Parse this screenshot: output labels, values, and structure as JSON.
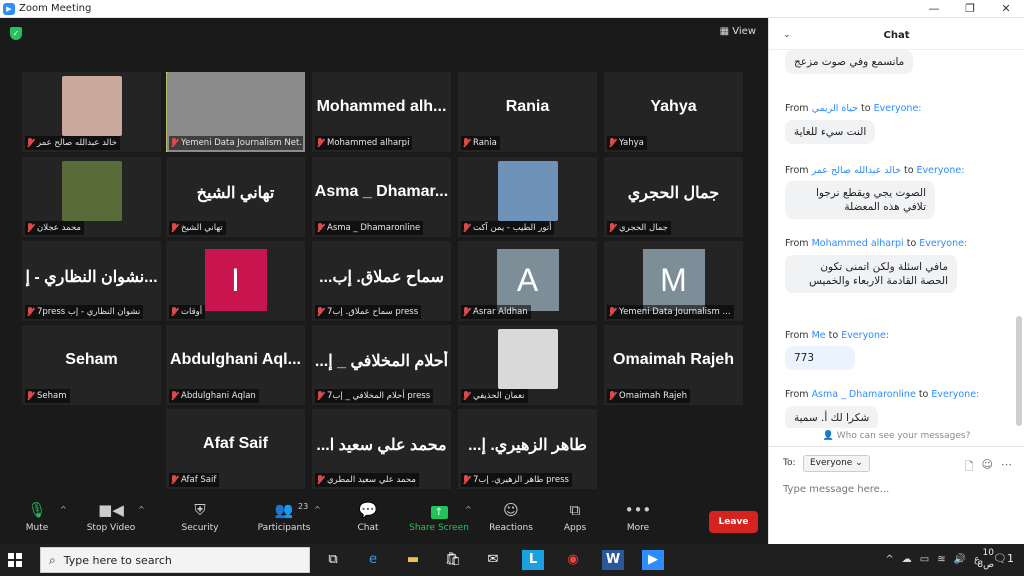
{
  "window": {
    "title": "Zoom Meeting",
    "minimize": "—",
    "maximize": "❐",
    "close": "✕"
  },
  "meeting": {
    "view_label": "View"
  },
  "tiles": [
    {
      "name": "",
      "label": "خالد عبدالله صالح عمر",
      "type": "photo",
      "photo_color": "#c9a99b"
    },
    {
      "name": "",
      "label": "Yemeni Data Journalism Net...",
      "type": "photo",
      "photo_color": "#8c8c8c",
      "active": true
    },
    {
      "name": "Mohammed  alh...",
      "label": "Mohammed alharpi",
      "type": "name"
    },
    {
      "name": "Rania",
      "label": "Rania",
      "type": "name"
    },
    {
      "name": "Yahya",
      "label": "Yahya",
      "type": "name"
    },
    {
      "name": "",
      "label": "محمد عجلان",
      "type": "photo",
      "photo_color": "#5a6b3a"
    },
    {
      "name": "تهاني الشيخ",
      "label": "تهاني الشيخ",
      "type": "name"
    },
    {
      "name": "Asma _ Dhamar...",
      "label": "Asma _ Dhamaronline",
      "type": "name"
    },
    {
      "name": "",
      "label": "أنور الطيب - يمن آكت",
      "type": "photo",
      "photo_color": "#6f93b8"
    },
    {
      "name": "جمال الحجري",
      "label": "جمال الحجري",
      "type": "name"
    },
    {
      "name": "نشوان النظاري - إ...",
      "label": "7press نشوان النظاري - إب",
      "type": "name"
    },
    {
      "name": "",
      "label": "أوقات",
      "type": "letter",
      "letter": "I",
      "letter_color": "#c8154f"
    },
    {
      "name": "...سماح عملاق. إب",
      "label": "7سماح عملاق. إب press",
      "type": "name"
    },
    {
      "name": "",
      "label": "Asrar Aldhan",
      "type": "letter",
      "letter": "A",
      "letter_color": "#7d8e99"
    },
    {
      "name": "",
      "label": "Yemeni Data Journalism ...",
      "type": "letter",
      "letter": "M",
      "letter_color": "#7d8e99"
    },
    {
      "name": "Seham",
      "label": "Seham",
      "type": "name"
    },
    {
      "name": "Abdulghani  Aql...",
      "label": "Abdulghani Aqlan",
      "type": "name"
    },
    {
      "name": "...أحلام المخلافي _ إ",
      "label": "7أحلام المخلافي _ إب press",
      "type": "name"
    },
    {
      "name": "",
      "label": "نعمان الحذيفي",
      "type": "photo",
      "photo_color": "#d9d9d9"
    },
    {
      "name": "Omaimah Rajeh",
      "label": "Omaimah Rajeh",
      "type": "name"
    },
    {
      "name": "Afaf Saif",
      "label": "Afaf Saif",
      "type": "name"
    },
    {
      "name": "...محمد علي سعيد ا",
      "label": "محمد علي سعيد المطري",
      "type": "name"
    },
    {
      "name": "...طاهر الزهيري. إ",
      "label": "7طاهر الزهيري. إب press",
      "type": "name"
    }
  ],
  "toolbar": {
    "mute": "Mute",
    "stop_video": "Stop Video",
    "security": "Security",
    "participants": "Participants",
    "participants_count": "23",
    "chat": "Chat",
    "share_screen": "Share Screen",
    "reactions": "Reactions",
    "apps": "Apps",
    "more": "More",
    "leave": "Leave"
  },
  "chat": {
    "title": "Chat",
    "messages": [
      {
        "from": "",
        "sender": "",
        "to": "",
        "text": "مانسمع وفي صوت مزعج"
      },
      {
        "from": "From",
        "sender": "حياة الريمي",
        "to": "Everyone:",
        "text": "النت سيء للغاية"
      },
      {
        "from": "From",
        "sender": "خالد عبدالله صالح عمر",
        "to": "Everyone:",
        "text": "الصوت يجي ويقطع نرجوا تلافي هذه المعضلة"
      },
      {
        "from": "From",
        "sender": "Mohammed alharpi",
        "to": "Everyone:",
        "text": "مافي اسئلة ولكن اتمنى تكون الحصة القادمة الاربعاء والخميس"
      },
      {
        "from": "From",
        "sender": "Me",
        "to": "Everyone:",
        "text": "773"
      },
      {
        "from": "From",
        "sender": "Asma _ Dhamaronline",
        "to": "Everyone:",
        "text": "شكرا لك أ. سمية"
      }
    ],
    "who_can_see": "Who can see your messages?",
    "to_label": "To:",
    "to_value": "Everyone",
    "input_placeholder": "Type message here..."
  },
  "taskbar": {
    "search_placeholder": "Type here to search",
    "clock_time": "10",
    "clock_date": "8ص",
    "notifications": "1",
    "lang": "ع"
  }
}
